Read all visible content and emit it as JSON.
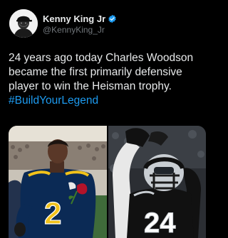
{
  "author": {
    "display_name": "Kenny King Jr",
    "handle": "@KennyKing_Jr",
    "avatar_icon": "avatar-illustration-icon",
    "verified_icon": "verified-badge-icon"
  },
  "tweet": {
    "text": "24 years ago today Charles Woodson became the first primarily defensive player to win the Heisman trophy. ",
    "hashtag": "#BuildYourLegend"
  },
  "media": {
    "photo_1": {
      "jersey_number": "2"
    },
    "photo_2": {
      "jersey_number": "24"
    }
  },
  "colors": {
    "background": "#000000",
    "text": "#e7e9ea",
    "muted": "#71767b",
    "link": "#1d9bf0",
    "michigan_blue": "#0b2a55",
    "michigan_maize": "#f2c21a",
    "raiders_black": "#111111",
    "raiders_silver": "#c9ced3"
  }
}
